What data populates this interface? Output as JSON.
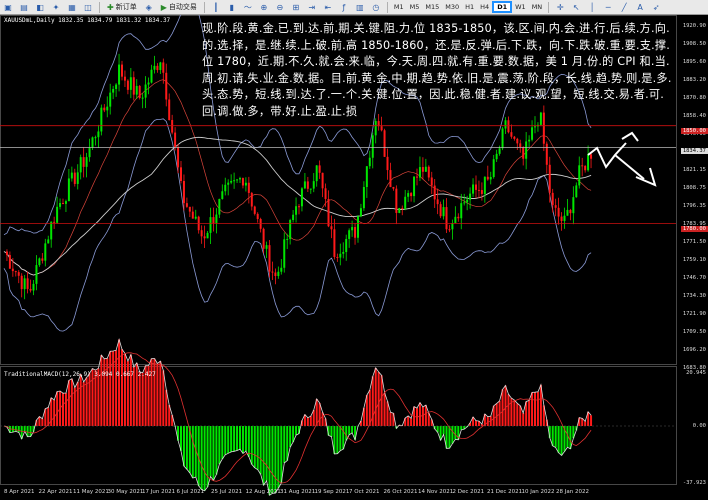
{
  "toolbar": {
    "new_order": "新订单",
    "auto_trading": "自动交易",
    "timeframes": [
      "M1",
      "M5",
      "M15",
      "M30",
      "H1",
      "H4",
      "D1",
      "W1",
      "MN"
    ],
    "active_timeframe": "D1"
  },
  "chart": {
    "symbol_info": "XAUUSDmL,Daily  1832.35  1834.79  1831.32  1834.37",
    "macd_info": "TraditionalMACD(12,26,9)  3.094  0.667  2.427",
    "annotation": "现.阶.段.黄.金.已.到.达.前.期.关.键.阻.力.位 1835-1850，该.区.间.内.会.进.行.后.续.方.向.的.选.择，是.继.续.上.破.前.高 1850-1860，还.是.反.弹.后.下.跌，向.下.跌.破.重.要.支.撑.位 1780，近.期.不.久.就.会.来.临，今.天.周.四.就.有.重.要.数.据，美 1 月.份.的 CPI 和.当.周.初.请.失.业.金.数.据。目.前.黄.金.中.期.趋.势.依.旧.是.震.荡.阶.段，长.线.趋.势.则.是.多.头.态.势，短.线.到.达.了.一.个.关.键.位.置，因.此.稳.健.者.建.议.观.望，短.线.交.易.者.可.回.调.做.多，带.好.止.盈.止.损",
    "price_axis": [
      "1920.90",
      "1908.50",
      "1895.60",
      "1883.20",
      "1870.80",
      "1858.40",
      "1846.00",
      "1833.60",
      "1821.15",
      "1808.75",
      "1796.35",
      "1783.95",
      "1771.50",
      "1759.10",
      "1746.70",
      "1734.30",
      "1721.90",
      "1709.50",
      "1696.20",
      "1683.80"
    ],
    "macd_axis": [
      "20.945",
      "0.00",
      "-37.923"
    ],
    "price_tags": [
      {
        "label": "1850.00",
        "color": "#cc2222"
      },
      {
        "label": "1834.37",
        "color": "#dddddd"
      },
      {
        "label": "1780.00",
        "color": "#cc2222"
      }
    ],
    "dates": [
      "8 Apr 2021",
      "22 Apr 2021",
      "11 May 2021",
      "30 May 2021",
      "17 Jun 2021",
      "6 Jul 2021",
      "25 Jul 2021",
      "12 Aug 2021",
      "31 Aug 2021",
      "19 Sep 2021",
      "7 Oct 2021",
      "26 Oct 2021",
      "14 Nov 2021",
      "2 Dec 2021",
      "21 Dec 2021",
      "10 Jan 2022",
      "28 Jan 2022"
    ]
  },
  "colors": {
    "bull": "#00e600",
    "bear": "#ff1a1a",
    "band": "#8a9ad6",
    "ma": "#cccccc",
    "level": "#cc1111"
  }
}
